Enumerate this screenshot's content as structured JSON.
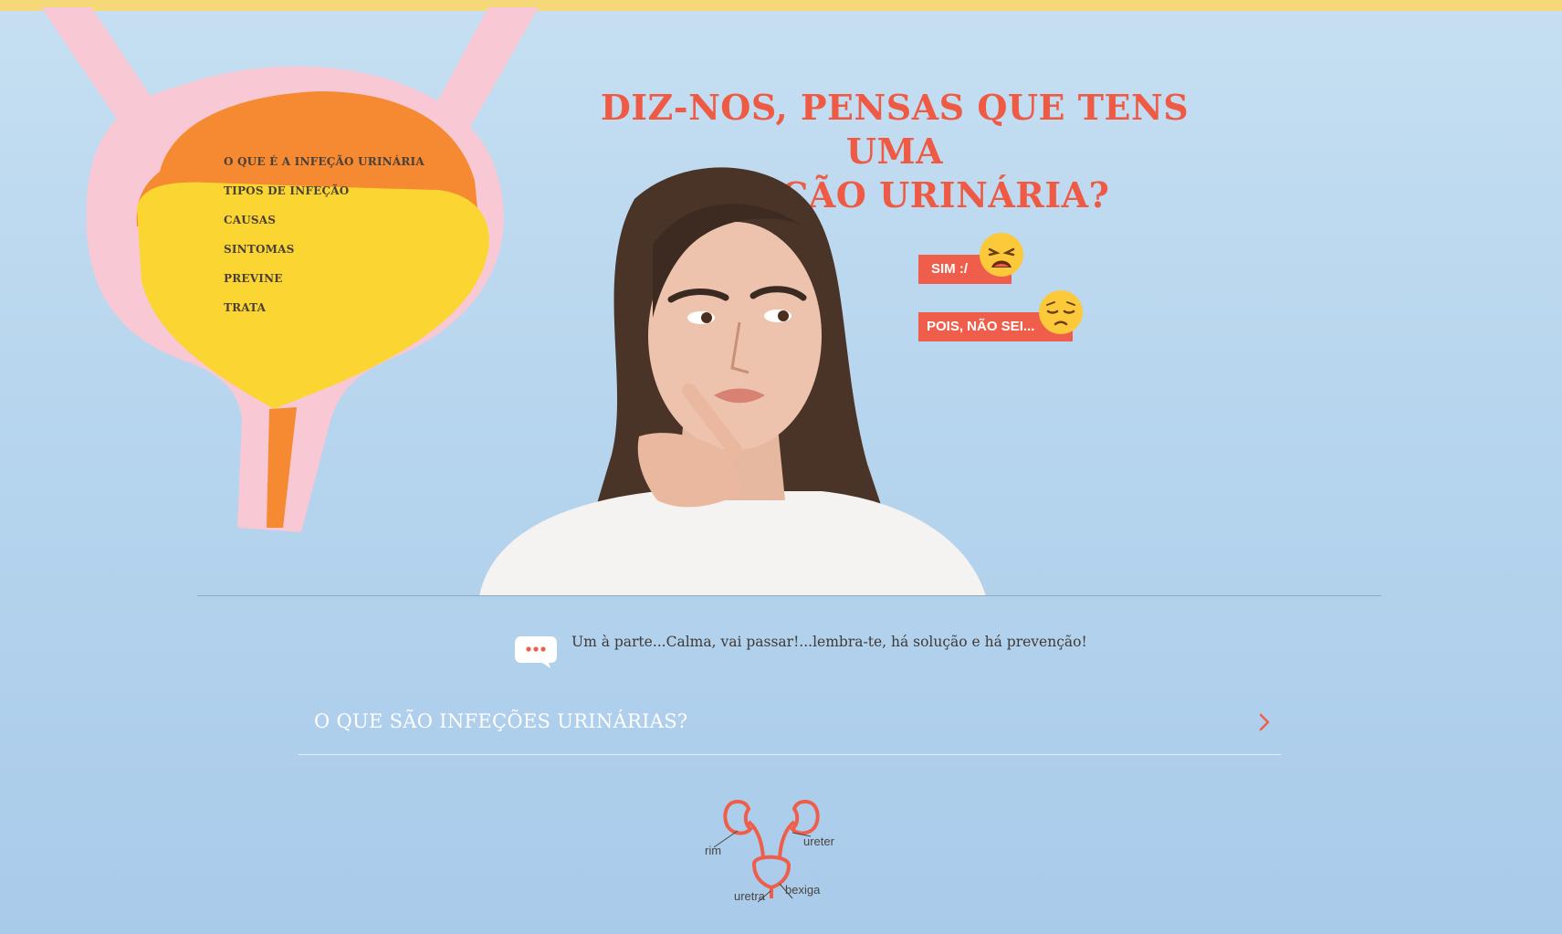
{
  "nav": {
    "items": [
      {
        "label": "O QUE É A INFEÇÃO URINÁRIA"
      },
      {
        "label": "TIPOS DE INFEÇÃO"
      },
      {
        "label": "CAUSAS"
      },
      {
        "label": "SINTOMAS"
      },
      {
        "label": "PREVINE"
      },
      {
        "label": "TRATA"
      }
    ]
  },
  "hero": {
    "headline_line1": "DIZ-NOS, PENSAS QUE TENS UMA",
    "headline_line2": "INFEÇÃO URINÁRIA?"
  },
  "answers": {
    "yes_label": "SIM :/",
    "yes_icon": "weary-face-icon",
    "maybe_label": "POIS, NÃO SEI...",
    "maybe_icon": "pensive-face-icon"
  },
  "note": {
    "icon": "speech-bubble-icon",
    "text": "Um à parte...Calma, vai passar!...lembra-te, há solução e há prevenção!"
  },
  "accordion": {
    "title": "O QUE SÃO INFEÇÕES URINÁRIAS?",
    "icon": "chevron-right-icon"
  },
  "diagram": {
    "labels": {
      "rim": "rim",
      "ureter": "ureter",
      "bexiga": "bexiga",
      "uretra": "uretra"
    }
  },
  "colors": {
    "accent": "#ef5e4a",
    "top_strip": "#f5d978",
    "background": "#b8d6ee"
  }
}
